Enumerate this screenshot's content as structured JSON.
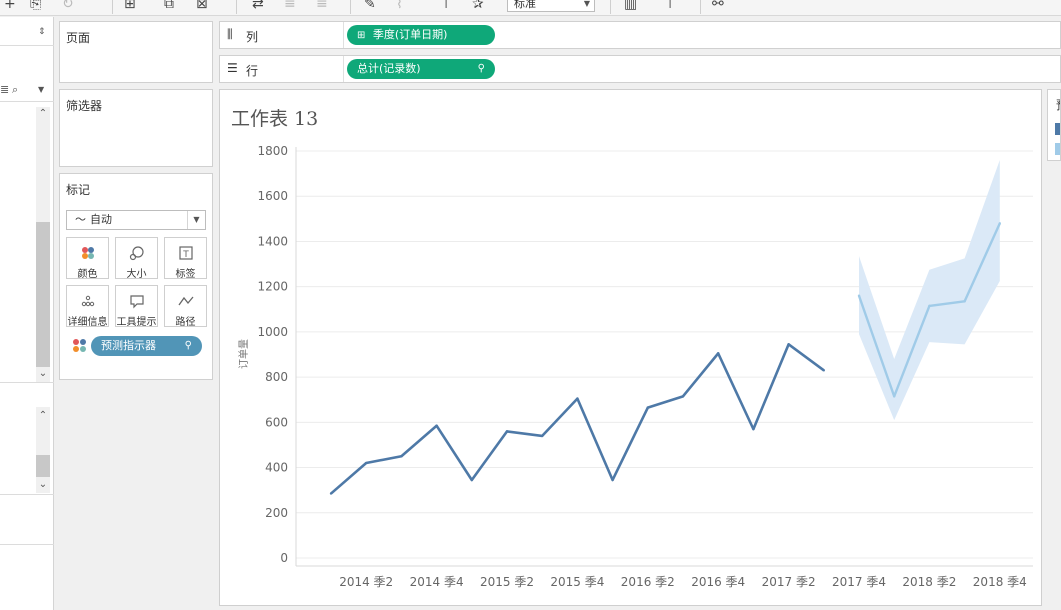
{
  "toolbar": {
    "view_select": "标准"
  },
  "shelves": {
    "pages_title": "页面",
    "filters_title": "筛选器",
    "marks_title": "标记",
    "mark_type": "自动",
    "mark_buttons": [
      {
        "label": "颜色"
      },
      {
        "label": "大小"
      },
      {
        "label": "标签"
      },
      {
        "label": "详细信息"
      },
      {
        "label": "工具提示"
      },
      {
        "label": "路径"
      }
    ],
    "mark_pill": "预测指示器",
    "columns_label": "列",
    "columns_pill": "季度(订单日期)",
    "rows_label": "行",
    "rows_pill": "总计(记录数)"
  },
  "legend": {
    "title": "预",
    "colors": [
      "#4e79a7",
      "#a0cbe8"
    ]
  },
  "sheet": {
    "title": "工作表 13"
  },
  "chart_data": {
    "type": "line",
    "ylabel": "订单量",
    "ylim": [
      0,
      1800
    ],
    "yticks": [
      0,
      200,
      400,
      600,
      800,
      1000,
      1200,
      1400,
      1600,
      1800
    ],
    "x_tick_labels": [
      "2014 季2",
      "2014 季4",
      "2015 季2",
      "2015 季4",
      "2016 季2",
      "2016 季4",
      "2017 季2",
      "2017 季4",
      "2018 季2",
      "2018 季4"
    ],
    "grid": true,
    "series": [
      {
        "color": "#4e79a7",
        "values": [
          285,
          420,
          450,
          585,
          345,
          560,
          540,
          705,
          345,
          665,
          715,
          905,
          570,
          945,
          830
        ]
      },
      {
        "color": "#a0cbe8",
        "values": [
          1160,
          715,
          1115,
          1135,
          1480
        ],
        "band_upper": [
          1335,
          880,
          1275,
          1325,
          1760
        ],
        "band_lower": [
          990,
          610,
          955,
          945,
          1225
        ]
      }
    ],
    "band_color": "#dbe9f7"
  }
}
